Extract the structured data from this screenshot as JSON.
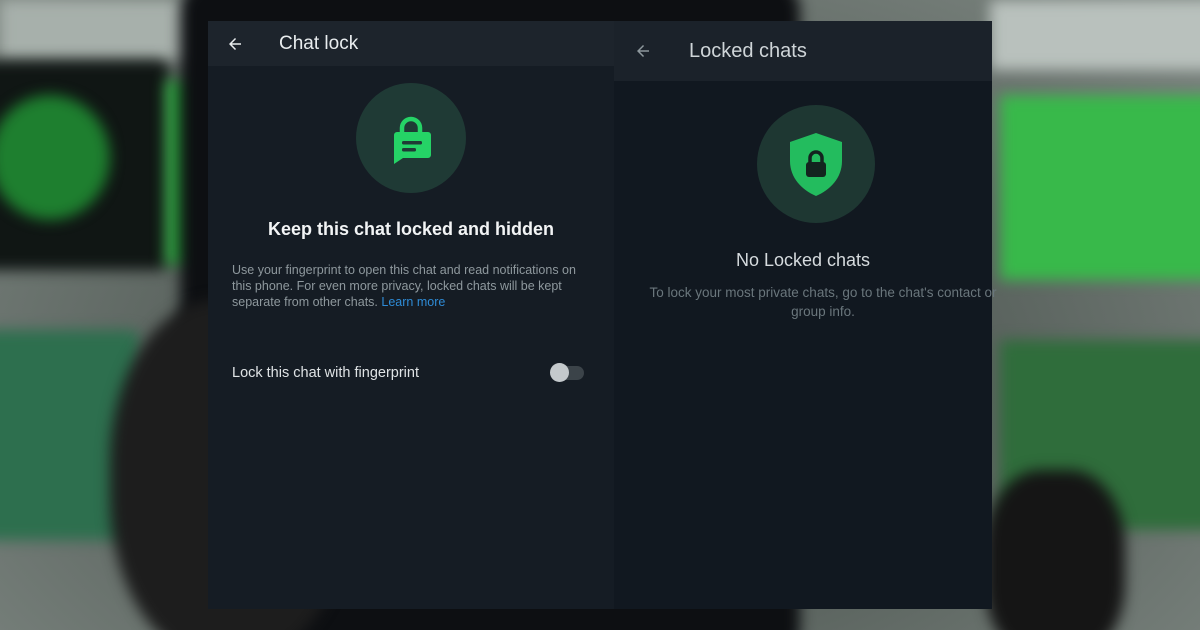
{
  "colors": {
    "accent_green": "#25d366",
    "panel_background": "#151c24",
    "link_blue": "#2e8bd6"
  },
  "left_panel": {
    "title": "Chat lock",
    "back_icon": "arrow-left-icon",
    "hero_icon": "lock-message-icon",
    "headline": "Keep this chat locked and hidden",
    "description": "Use your fingerprint to open this chat and read notifications on this phone. For even more privacy, locked chats will be kept separate from other chats.",
    "learn_more": "Learn more",
    "fingerprint_toggle": {
      "label": "Lock this chat with fingerprint",
      "enabled": false
    }
  },
  "right_panel": {
    "title": "Locked chats",
    "back_icon": "arrow-left-icon",
    "hero_icon": "shield-lock-icon",
    "empty_title": "No Locked chats",
    "empty_description": "To lock your most private chats, go to the chat's contact or group info."
  }
}
